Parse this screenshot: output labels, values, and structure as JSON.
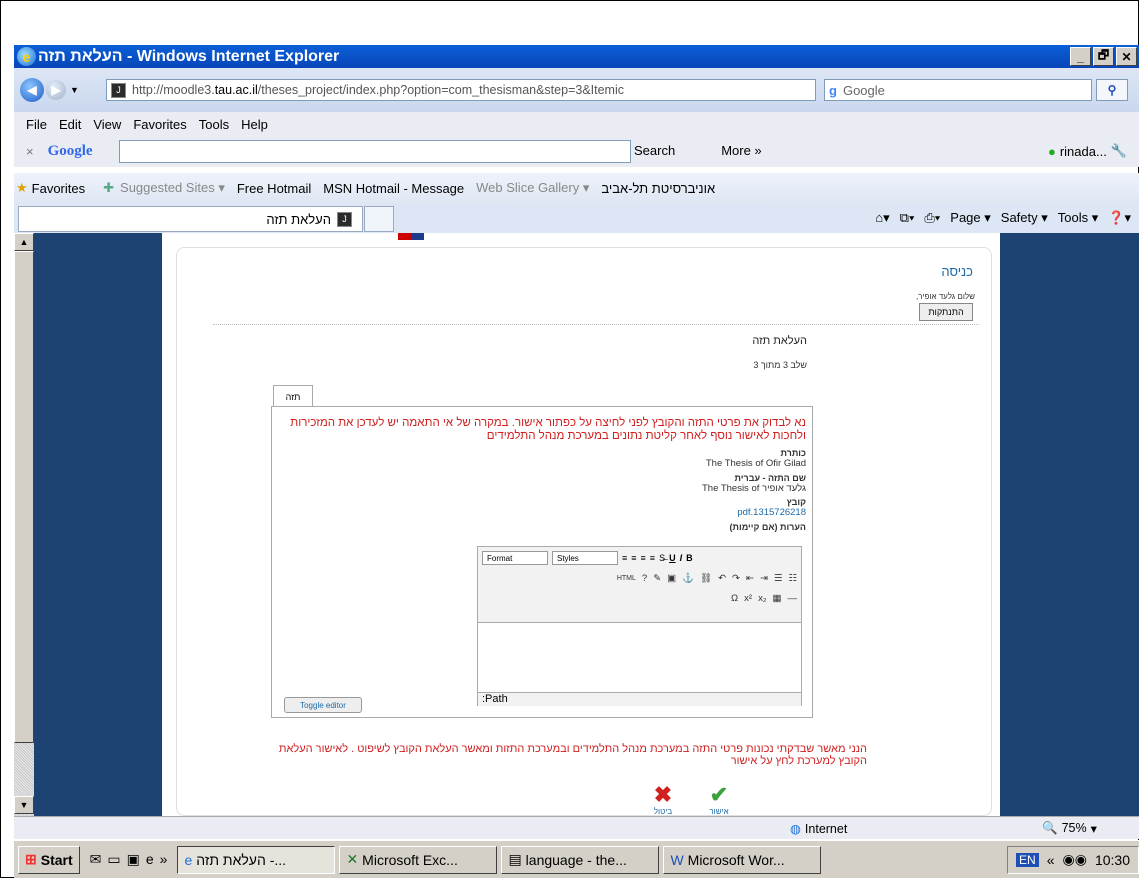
{
  "window": {
    "title": "העלאת תזה - Windows Internet Explorer",
    "buttons": [
      "_",
      "🗗",
      "✕"
    ]
  },
  "address": {
    "url_prefix": "http://moodle3.",
    "url_host": "tau.ac.il",
    "url_rest": "/theses_project/index.php?option=com_thesisman&step=3&Itemic",
    "search_engine": "Google"
  },
  "menu": [
    "File",
    "Edit",
    "View",
    "Favorites",
    "Tools",
    "Help"
  ],
  "googlebar": {
    "logo": "Google",
    "search_label": "Search",
    "more_label": "More »",
    "user": "rinada..."
  },
  "favorites": {
    "label": "Favorites",
    "items": [
      "Suggested Sites ▾",
      "Free Hotmail",
      "MSN Hotmail - Message",
      "Web Slice Gallery ▾",
      "אוניברסיטת תל-אביב"
    ]
  },
  "tab": {
    "title": "העלאת תזה",
    "commands": [
      "Page ▾",
      "Safety ▾",
      "Tools ▾"
    ]
  },
  "page": {
    "login_header": "כניסה",
    "hello": "שלום גלעד אופיר,",
    "logout": "התנתקות",
    "title": "העלאת תזה",
    "step": "שלב 3 מתוך 3",
    "tab_label": "תזה",
    "warning": "נא לבדוק את פרטי התזה והקובץ לפני לחיצה על כפתור אישור. במקרה של אי התאמה יש לעדכן את המזכירות ולחכות לאישור נוסף לאחר קליטת נתונים במערכת מנהל התלמידים",
    "label_title": "כותרת",
    "value_title": "The Thesis of Ofir Gilad",
    "label_heb_name": "שם התזה - עברית",
    "value_heb_name": "The Thesis of גלעד אופיר",
    "label_file": "קובץ",
    "value_file": "pdf.1315726218",
    "label_notes": "הערות (אם קיימות)",
    "format_select": "Format",
    "styles_select": "Styles",
    "path_label": ":Path",
    "toggle_editor": "Toggle editor",
    "confirm_text": "הנני מאשר שבדקתי נכונות פרטי התזה במערכת מנהל התלמידים ובמערכת התזות ומאשר העלאת הקובץ לשיפוט . לאישור העלאת הקובץ למערכת לחץ על אישור",
    "cancel_label": "ביטול",
    "approve_label": "אישור"
  },
  "status": {
    "zone": "Internet",
    "zoom": "75%"
  },
  "taskbar": {
    "start": "Start",
    "items": [
      "העלאת תזה -...",
      "Microsoft Exc...",
      "language - the...",
      "Microsoft Wor..."
    ],
    "lang": "EN",
    "time": "10:30"
  }
}
